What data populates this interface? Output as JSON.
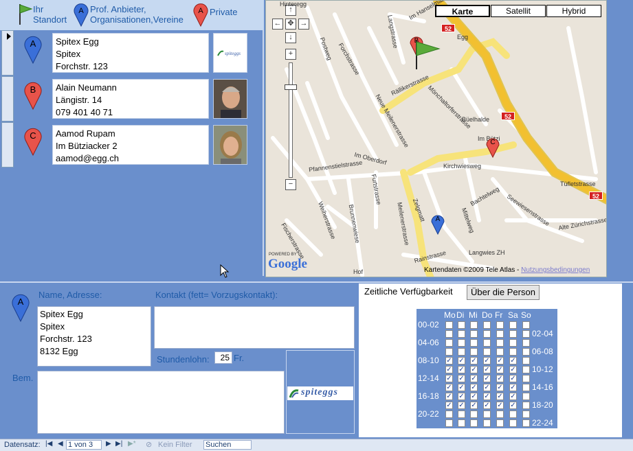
{
  "legend": {
    "own": "Ihr Standort",
    "prof": "Prof. Anbieter, Organisationen,Vereine",
    "private": "Private"
  },
  "records": [
    {
      "marker": "A",
      "line1": "Spitex Egg",
      "line2": "Spitex",
      "line3": "Forchstr. 123",
      "image": "spiteggs-logo"
    },
    {
      "marker": "B",
      "line1": "Alain Neumann",
      "line2": "Längistr. 14",
      "line3": "079 401 40 71",
      "image": "person-photo"
    },
    {
      "marker": "C",
      "line1": "Aamod Rupam",
      "line2": "Im Bützi­acker 2",
      "line3": "aamod@egg.ch",
      "image": "person-photo"
    }
  ],
  "map": {
    "types": [
      "Karte",
      "Satellit",
      "Hybrid"
    ],
    "selected": "Karte",
    "copyright": "Kartendaten ©2009 Tele Atlas - ",
    "terms": "Nutzungsbedingungen",
    "powered": "POWERED BY",
    "google": "Google",
    "labels": [
      "Hinteregg",
      "Im Hanselmaa",
      "Egg",
      "Rällikerstrasse",
      "Mönchaltorferstrasse",
      "Kirchwiesweg",
      "Tüfletstrasse",
      "Pfannenstielstrasse",
      "Weiherstrasse",
      "Brunnenwiese",
      "Fischerstrasse",
      "Rainstrasse",
      "Langwies ZH",
      "Alte Zürichstrasse",
      "Zelgmatt",
      "Mittelweg",
      "Bachtelweg",
      "Seewiesenstrasse",
      "Forchstrasse",
      "Im Oberdorf",
      "Neue Meilenerstrasse",
      "Langstrasse",
      "Büelhalde",
      "Meilenerstrasse",
      "Hof",
      "Furtstrasse",
      "Postweg",
      "Im Bützi"
    ],
    "route_numbers": [
      "52",
      "52",
      "52"
    ]
  },
  "detail": {
    "marker": "A",
    "name_label": "Name, Adresse:",
    "address": [
      "Spitex Egg",
      "Spitex",
      "Forchstr. 123",
      "8132 Egg"
    ],
    "contact_label": "Kontakt (fett= Vorzugskontakt):",
    "rate_label": "Stundenlohn:",
    "rate_value": "25",
    "rate_unit": "Fr.",
    "remarks_label": "Bem.",
    "logo_text": "spiteggs"
  },
  "availability": {
    "title": "Zeitliche Verfügbarkeit",
    "about_button": "Über die Person",
    "days": [
      "Mo",
      "Di",
      "Mi",
      "Do",
      "Fr",
      "Sa",
      "So"
    ],
    "left_slots": [
      "00-02",
      "04-06",
      "08-10",
      "12-14",
      "16-18",
      "20-22"
    ],
    "right_slots": [
      "02-04",
      "06-08",
      "10-12",
      "14-16",
      "18-20",
      "22-24"
    ],
    "checked_rows": [
      4,
      5,
      6,
      7,
      8,
      9
    ]
  },
  "statusbar": {
    "record_label": "Datensatz:",
    "position": "1 von 3",
    "filter": "Kein Filter",
    "search": "Suchen"
  },
  "colors": {
    "marker_blue": "#3a6fd8",
    "marker_red": "#e8534a",
    "panel": "#6a8fcc",
    "label": "#1f5ba8"
  }
}
